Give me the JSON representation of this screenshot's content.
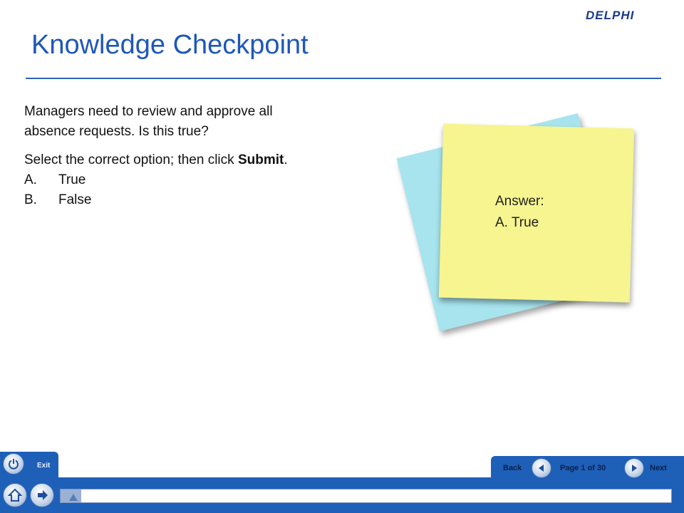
{
  "brand": {
    "logo_text": "DELPHI"
  },
  "page": {
    "title": "Knowledge Checkpoint"
  },
  "question": {
    "line1": "Managers need to review and approve all",
    "line2": "absence requests.  Is this true?",
    "instruction_prefix": "Select the correct option; then click ",
    "instruction_bold": "Submit",
    "instruction_suffix": ".",
    "options": [
      {
        "letter": "A.",
        "text": "True"
      },
      {
        "letter": "B.",
        "text": "False"
      }
    ]
  },
  "answer_note": {
    "label": "Answer:",
    "value": "A. True"
  },
  "footer": {
    "exit_label": "Exit",
    "back_label": "Back",
    "next_label": "Next",
    "page_indicator": "Page 1 of 30",
    "progress_fraction": 0.0333
  },
  "colors": {
    "accent": "#1e5fb8",
    "title": "#1f57b8",
    "note_yellow": "#f6f58f",
    "note_blue": "#a7e4ee"
  },
  "icons": {
    "exit": "power-icon",
    "home": "home-icon",
    "resume": "arrow-right-icon",
    "back": "arrow-left-icon",
    "next": "arrow-right-icon"
  }
}
